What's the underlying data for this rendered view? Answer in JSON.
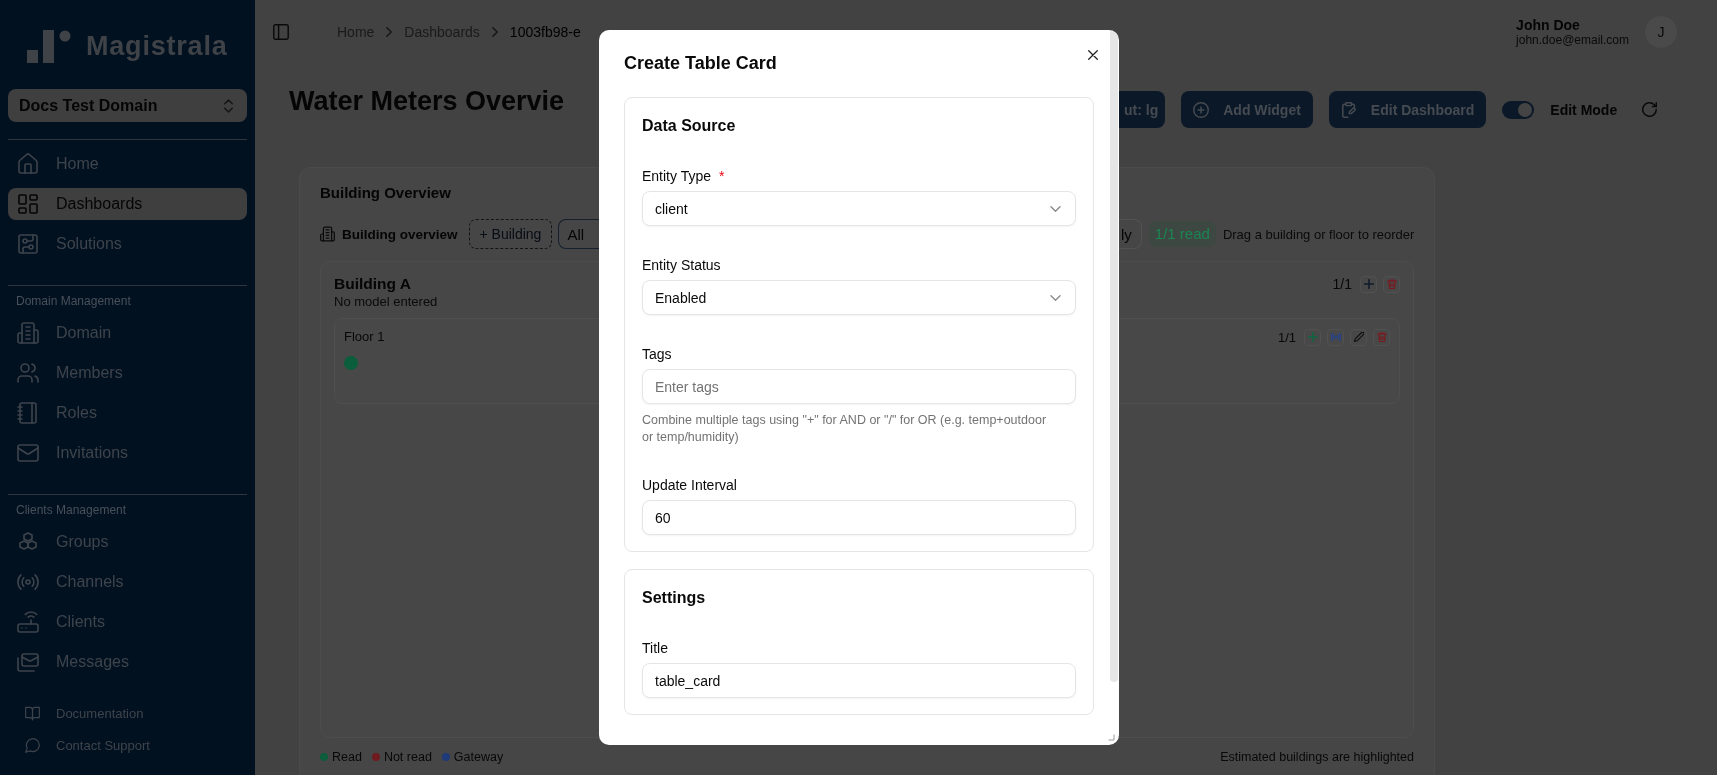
{
  "sidebar": {
    "logo": "Magistrala",
    "domain_selector": "Docs Test Domain",
    "nav_sections": [
      {
        "items": [
          {
            "label": "Home",
            "selected": false
          },
          {
            "label": "Dashboards",
            "selected": true
          },
          {
            "label": "Solutions",
            "selected": false
          }
        ]
      },
      {
        "heading": "Domain Management",
        "items": [
          {
            "label": "Domain",
            "selected": false
          },
          {
            "label": "Members",
            "selected": false
          },
          {
            "label": "Roles",
            "selected": false
          },
          {
            "label": "Invitations",
            "selected": false
          }
        ]
      },
      {
        "heading": "Clients Management",
        "items": [
          {
            "label": "Groups",
            "selected": false
          },
          {
            "label": "Channels",
            "selected": false
          },
          {
            "label": "Clients",
            "selected": false
          },
          {
            "label": "Messages",
            "selected": false
          }
        ]
      }
    ],
    "footer_links": [
      "Documentation",
      "Contact Support"
    ]
  },
  "header": {
    "breadcrumbs": [
      {
        "label": "Home",
        "current": false
      },
      {
        "label": "Dashboards",
        "current": false
      },
      {
        "label": "1003fb98-e",
        "current": true
      }
    ],
    "user": {
      "name": "John Doe",
      "email": "john.doe@email.com",
      "avatar": "J"
    }
  },
  "page": {
    "title": "Water Meters Overvie",
    "actions": [
      "ut: lg",
      "Add Widget",
      "Edit Dashboard"
    ],
    "edit_mode": {
      "label": "Edit Mode",
      "on": true
    }
  },
  "widget": {
    "title": "Building Overview",
    "toolbar": {
      "heading": "Building overview",
      "add_button": "+ Building",
      "filters": [
        {
          "label": "All",
          "selected": true
        },
        {
          "label": "ly",
          "selected": false
        }
      ],
      "read_badge": "1/1 read",
      "hint": "Drag a building or floor to reorder"
    },
    "buildings": [
      {
        "name": "Building A",
        "model": "No model entered",
        "count": "1/1",
        "floors": [
          {
            "name": "Floor 1",
            "count": "1/1",
            "meters": [
              {
                "color": "#0b5e3c"
              }
            ]
          }
        ]
      }
    ],
    "legend": [
      {
        "label": "Read",
        "color": "#0d5c3c"
      },
      {
        "label": "Not read",
        "color": "#6e1a1f"
      },
      {
        "label": "Gateway",
        "color": "#1f3a7a"
      }
    ],
    "note": "Estimated buildings are highlighted"
  },
  "dialog": {
    "title": "Create Table Card",
    "sections": [
      {
        "title": "Data Source",
        "fields": [
          {
            "kind": "select",
            "label": "Entity Type",
            "required_mark": "*",
            "value": "client"
          },
          {
            "kind": "select",
            "label": "Entity Status",
            "value": "Enabled"
          },
          {
            "kind": "text",
            "label": "Tags",
            "placeholder": "Enter tags",
            "help": "Combine multiple tags using \"+\" for AND or \"/\" for OR (e.g. temp+outdoor or temp/humidity)"
          },
          {
            "kind": "text",
            "label": "Update Interval",
            "value": "60"
          }
        ]
      },
      {
        "title": "Settings",
        "fields": [
          {
            "kind": "text",
            "label": "Title",
            "value": "table_card"
          }
        ]
      }
    ]
  }
}
